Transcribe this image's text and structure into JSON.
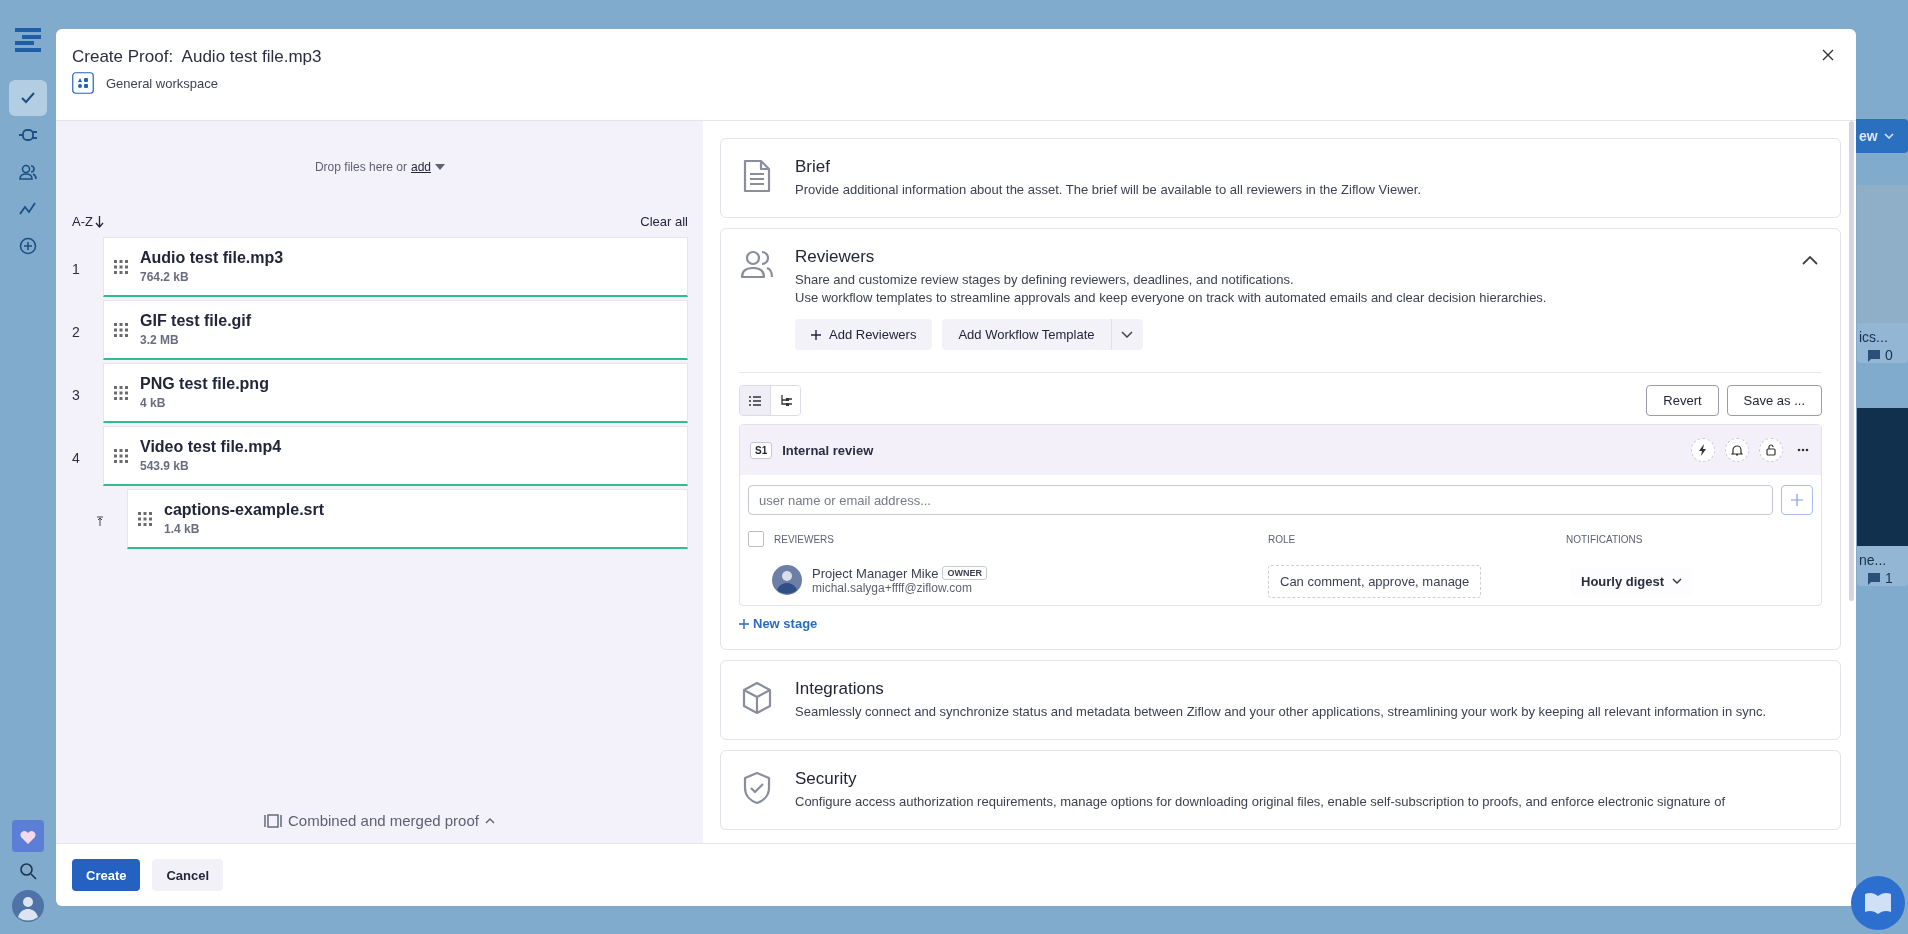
{
  "app_rail": {
    "items": [
      {
        "kind": "check",
        "selected": true
      },
      {
        "kind": "plug",
        "selected": false
      },
      {
        "kind": "people",
        "selected": false
      },
      {
        "kind": "chart",
        "selected": false
      },
      {
        "kind": "plus",
        "selected": false
      }
    ],
    "bottom": [
      {
        "kind": "heart"
      },
      {
        "kind": "search"
      },
      {
        "kind": "avatar"
      }
    ]
  },
  "background": {
    "button_label": "ew",
    "cards": [
      {
        "title": "ics...",
        "comments": "0"
      },
      {
        "title": "ne...",
        "comments": "1"
      }
    ]
  },
  "dialog": {
    "title": "Create Proof:  Audio test file.mp3",
    "workspace": "General workspace"
  },
  "uploader": {
    "drop_text": "Drop files here or",
    "add_link": "add",
    "sort": "A-Z",
    "clear": "Clear all",
    "combined": "Combined and merged proof",
    "files": [
      {
        "number": "1",
        "name": "Audio test file.mp3",
        "size": "764.2 kB"
      },
      {
        "number": "2",
        "name": "GIF test file.gif",
        "size": "3.2 MB"
      },
      {
        "number": "3",
        "name": "PNG test file.png",
        "size": "4 kB"
      },
      {
        "number": "4",
        "name": "Video test file.mp4",
        "size": "543.9 kB",
        "children": [
          {
            "name": "captions-example.srt",
            "size": "1.4 kB"
          }
        ]
      }
    ]
  },
  "sections": [
    {
      "kind": "brief",
      "title": "Brief",
      "description": [
        "Provide additional information about the asset. The brief will be available to all reviewers in the Ziflow Viewer."
      ]
    },
    {
      "kind": "reviewers",
      "title": "Reviewers",
      "expanded": true,
      "description": [
        "Share and customize review stages by defining reviewers, deadlines, and notifications.",
        "Use workflow templates to streamline approvals and keep everyone on track with automated emails and clear decision hierarchies."
      ]
    },
    {
      "kind": "integrations",
      "title": "Integrations",
      "description": [
        "Seamlessly connect and synchronize status and metadata between Ziflow and your other applications, streamlining your work by keeping all relevant information in sync."
      ]
    },
    {
      "kind": "security",
      "title": "Security",
      "description": [
        "Configure access authorization requirements, manage options for downloading original files, enable self-subscription to proofs, and enforce electronic signature of"
      ]
    }
  ],
  "reviewers_panel": {
    "add_reviewers": "Add Reviewers",
    "add_template": "Add Workflow Template",
    "view_toggle": [
      {
        "kind": "list",
        "selected": true
      },
      {
        "kind": "tree",
        "selected": false
      }
    ],
    "revert": "Revert",
    "save_as": "Save as ...",
    "new_stage": "New stage",
    "stage": {
      "select_all_checked": false,
      "badge": "S1",
      "name": "Internal review",
      "placeholder": "user name or email address...",
      "columns": [
        "REVIEWERS",
        "ROLE",
        "NOTIFICATIONS"
      ],
      "reviewers": [
        {
          "name": "Project Manager Mike",
          "badge": "OWNER",
          "email": "michal.salyga+ffff@ziflow.com",
          "role": "Can comment, approve, manage",
          "notifications": "Hourly digest"
        }
      ]
    }
  },
  "footer": {
    "buttons": [
      {
        "kind": "primary",
        "label": "Create"
      },
      {
        "kind": "secondary",
        "label": "Cancel"
      }
    ]
  }
}
